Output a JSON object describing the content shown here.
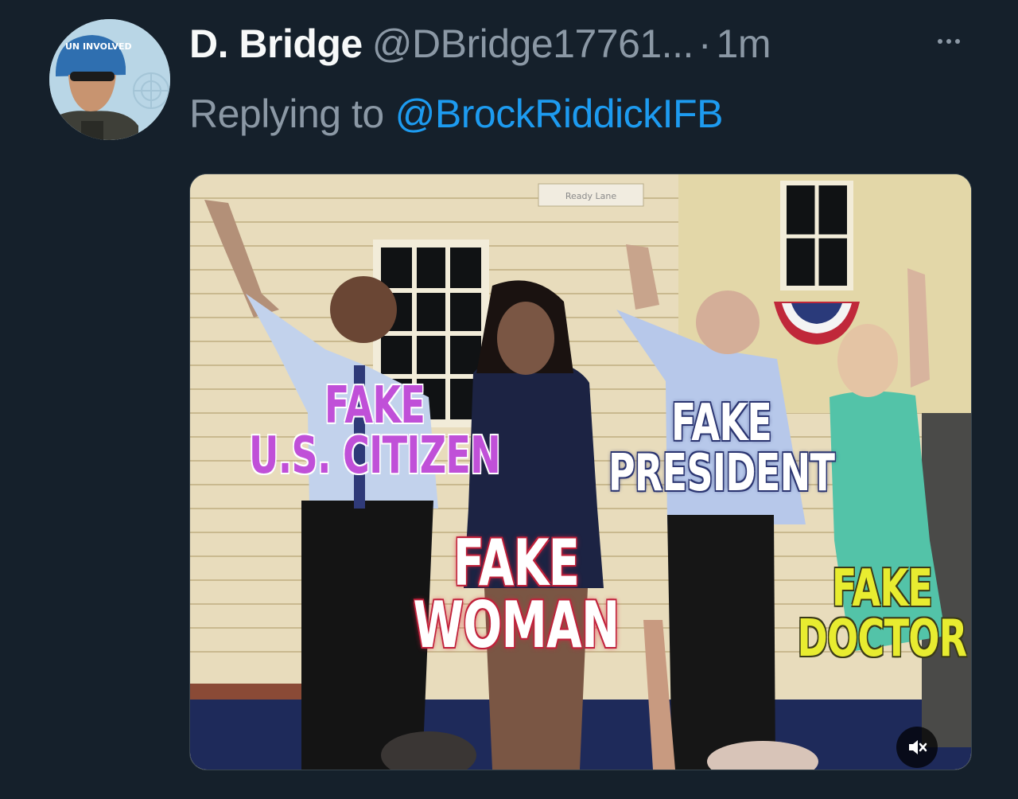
{
  "tweet": {
    "author": {
      "display_name": "D. Bridge",
      "handle": "@DBridge17761...",
      "avatar_text": "UN INVOLVED"
    },
    "separator": "·",
    "time": "1m",
    "reply": {
      "prefix": "Replying to",
      "handle": "@BrockRiddickIFB"
    }
  },
  "media": {
    "sign_text": "Ready Lane",
    "labels": {
      "citizen": "FAKE\nU.S. CITIZEN",
      "president": "FAKE\nPRESIDENT",
      "woman": "FAKE\nWOMAN",
      "doctor": "FAKE\nDOCTOR"
    },
    "mute_icon": "speaker-muted-icon"
  },
  "colors": {
    "background": "#15202b",
    "text_primary": "#f7f9f9",
    "text_secondary": "#8b98a5",
    "link": "#1d9bf0"
  }
}
